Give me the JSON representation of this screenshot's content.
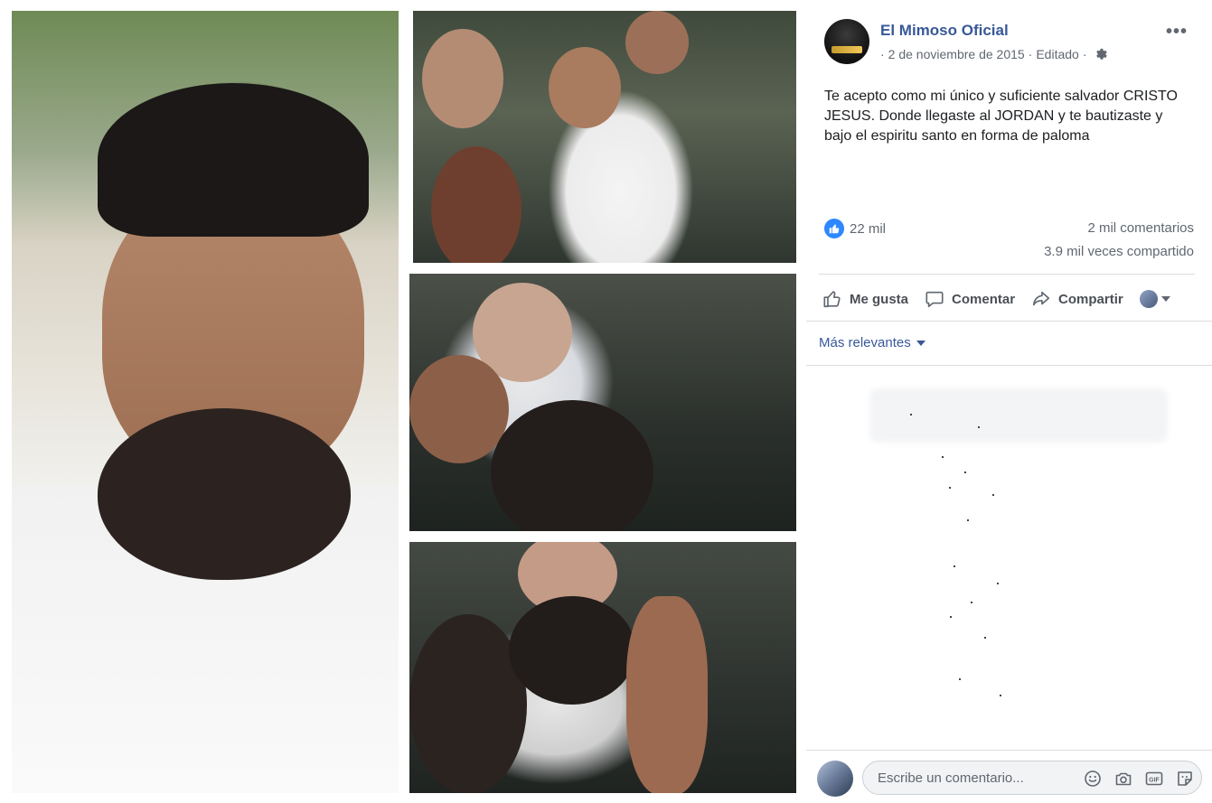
{
  "post": {
    "page_name": "El Mimoso Oficial",
    "date": "2 de noviembre de 2015",
    "edited": "Editado",
    "separator": "·",
    "more_label": "•••",
    "text": "Te acepto como mi único y suficiente salvador CRISTO JESUS. Donde llegaste al JORDAN y te bautizaste y bajo el espiritu santo en forma de paloma"
  },
  "stats": {
    "likes": "22 mil",
    "comments": "2 mil comentarios",
    "shares": "3.9 mil veces compartido"
  },
  "actions": {
    "like": "Me gusta",
    "comment": "Comentar",
    "share": "Compartir"
  },
  "comments_filter": "Más relevantes",
  "comment_box": {
    "placeholder": "Escribe un comentario..."
  },
  "icons": {
    "like_badge": "thumbs-up-icon",
    "gear": "gear-icon",
    "emoji": "emoji-icon",
    "camera": "camera-icon",
    "gif": "gif-icon",
    "sticker": "sticker-icon"
  },
  "colors": {
    "link": "#385898",
    "like_blue": "#2d88ff",
    "muted": "#606770"
  }
}
